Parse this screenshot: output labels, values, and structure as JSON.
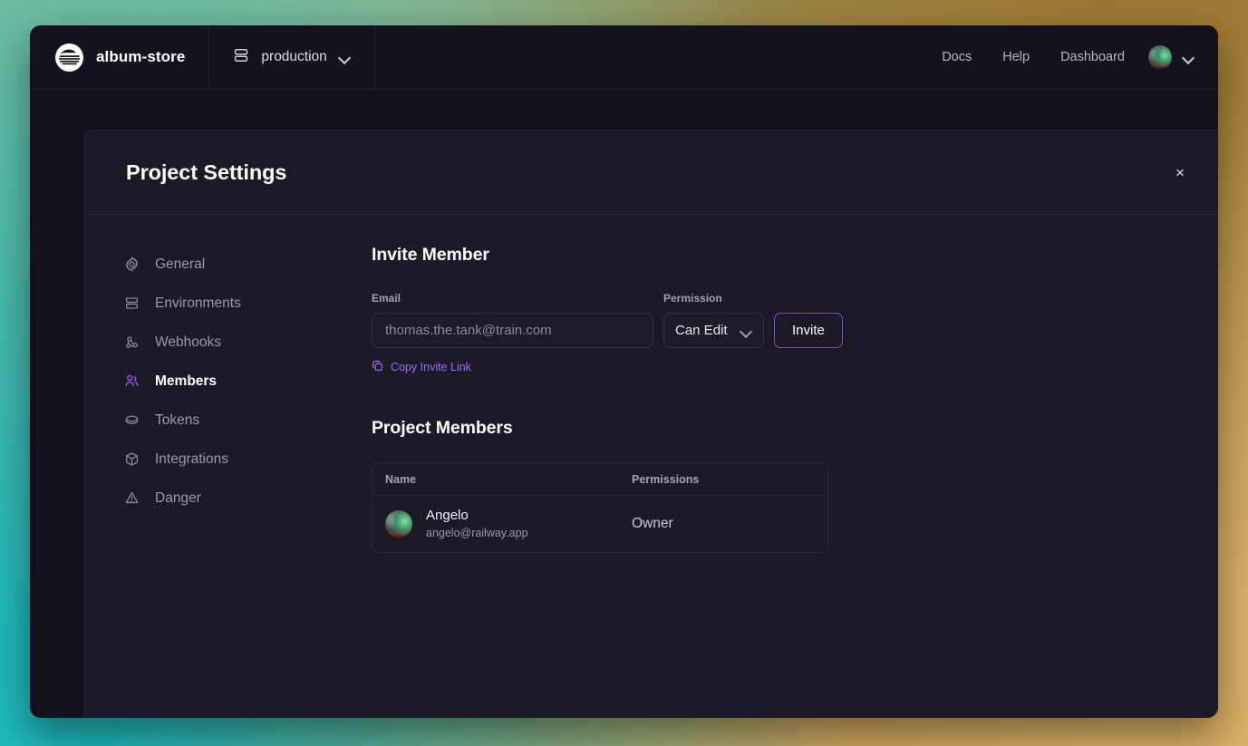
{
  "topbar": {
    "logo_icon": "railway-train-logo",
    "project_name": "album-store",
    "environment_icon": "environment-stack-icon",
    "environment_name": "production",
    "environment_chevron_icon": "chevron-down-icon",
    "links": [
      {
        "label": "Docs"
      },
      {
        "label": "Help"
      },
      {
        "label": "Dashboard"
      }
    ],
    "user_avatar_icon": "user-avatar",
    "user_chevron_icon": "chevron-down-icon"
  },
  "modal": {
    "title": "Project Settings",
    "close_icon": "close-icon",
    "close_label": "×"
  },
  "sidebar": {
    "items": [
      {
        "label": "General",
        "icon": "gear-icon",
        "active": false
      },
      {
        "label": "Environments",
        "icon": "stack-icon",
        "active": false
      },
      {
        "label": "Webhooks",
        "icon": "webhook-icon",
        "active": false
      },
      {
        "label": "Members",
        "icon": "users-icon",
        "active": true
      },
      {
        "label": "Tokens",
        "icon": "token-icon",
        "active": false
      },
      {
        "label": "Integrations",
        "icon": "cube-icon",
        "active": false
      },
      {
        "label": "Danger",
        "icon": "warning-icon",
        "active": false
      }
    ]
  },
  "invite": {
    "heading": "Invite Member",
    "email_label": "Email",
    "email_value": "",
    "email_placeholder": "thomas.the.tank@train.com",
    "permission_label": "Permission",
    "permission_value": "Can Edit",
    "permission_options": [
      "Can Edit"
    ],
    "permission_chevron_icon": "chevron-down-icon",
    "invite_button": "Invite",
    "copy_link_label": "Copy Invite Link",
    "copy_link_icon": "copy-icon"
  },
  "members": {
    "heading": "Project Members",
    "columns": [
      "Name",
      "Permissions"
    ],
    "rows": [
      {
        "avatar_icon": "member-avatar",
        "name": "Angelo",
        "email": "angelo@railway.app",
        "permission": "Owner"
      }
    ]
  },
  "colors": {
    "accent_purple": "#a855f7",
    "invite_border": "#7b4dbd",
    "link_purple": "#a06cf0",
    "window_bg": "#13121c",
    "topbar_bg": "#14131d",
    "modal_bg": "#1b1a26",
    "backdrop_teal": "#1fb9bd",
    "backdrop_green": "#77bd9e",
    "backdrop_gold": "#dcb067",
    "backdrop_bronze": "#8e6d27"
  }
}
